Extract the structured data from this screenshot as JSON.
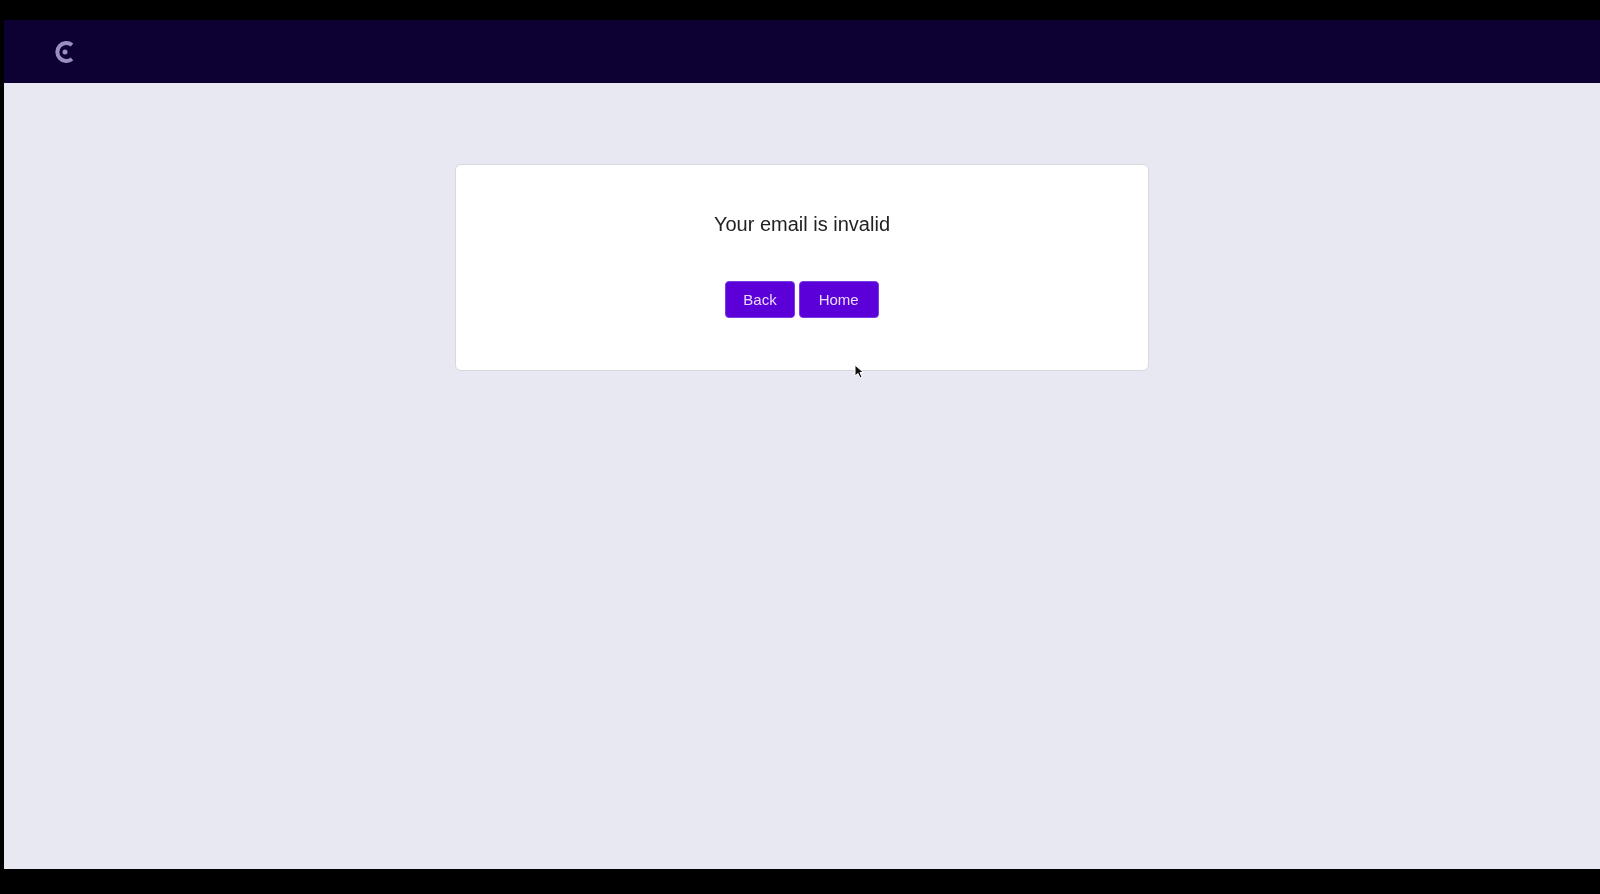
{
  "message": "Your email is invalid",
  "buttons": [
    {
      "label": "Back"
    },
    {
      "label": "Home"
    }
  ]
}
